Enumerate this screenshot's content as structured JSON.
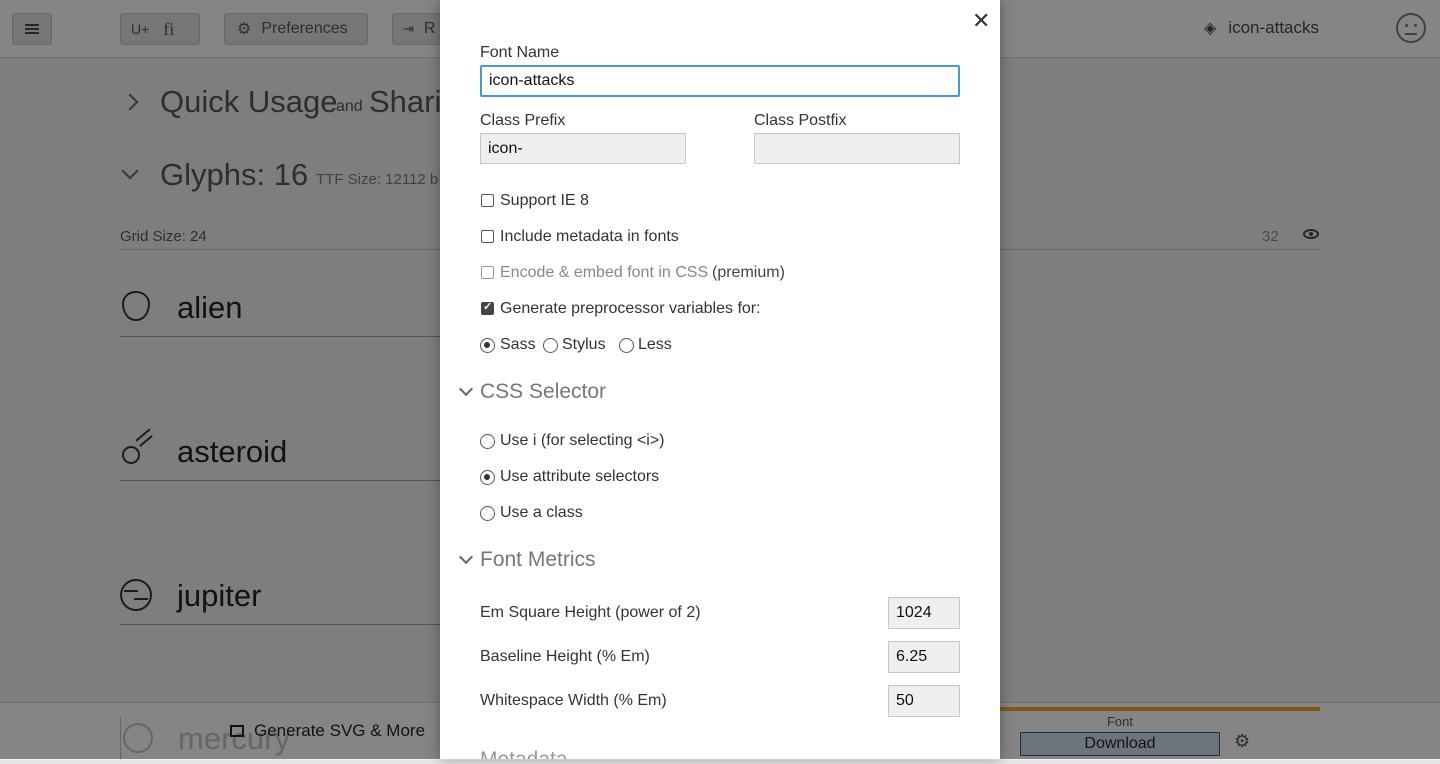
{
  "toolbar": {
    "unicode_btn": "U+",
    "ligature_btn": "fi",
    "preferences_label": "Preferences",
    "r_btn_label": "R",
    "project_name": "icon-attacks"
  },
  "main": {
    "quick_usage_title": "Quick Usage",
    "quick_usage_and": "and",
    "quick_usage_sharing": "Shari",
    "glyphs_title": "Glyphs: 16",
    "ttf_size": "TTF Size: 12112 b",
    "grid_size": "Grid Size: 24",
    "grid_value": "32",
    "glyphs": [
      {
        "name": "alien",
        "icon": "alien-icon"
      },
      {
        "name": "asteroid",
        "icon": "asteroid-icon"
      },
      {
        "name": "jupiter",
        "icon": "jupiter-icon"
      },
      {
        "name": "mercury",
        "icon": "mercury-icon"
      }
    ]
  },
  "bottombar": {
    "generate_label": "Generate SVG & More",
    "font_caption": "Font",
    "download_label": "Download"
  },
  "modal": {
    "font_name_label": "Font Name",
    "font_name_value": "icon-attacks",
    "class_prefix_label": "Class Prefix",
    "class_prefix_value": "icon-",
    "class_postfix_label": "Class Postfix",
    "class_postfix_value": "",
    "support_ie8": "Support IE 8",
    "include_metadata": "Include metadata in fonts",
    "encode_embed": "Encode & embed font in CSS",
    "premium": "(premium)",
    "generate_preprocessor": "Generate preprocessor variables for:",
    "preprocessors": [
      "Sass",
      "Stylus",
      "Less"
    ],
    "css_selector_title": "CSS Selector",
    "selector_options": [
      "Use i (for selecting <i>)",
      "Use attribute selectors",
      "Use a class"
    ],
    "font_metrics_title": "Font Metrics",
    "em_square_label": "Em Square Height (power of 2)",
    "em_square_value": "1024",
    "baseline_label": "Baseline Height (% Em)",
    "baseline_value": "6.25",
    "whitespace_label": "Whitespace Width (% Em)",
    "whitespace_value": "50",
    "metadata_title": "Metadata"
  },
  "colors": {
    "accent_focus": "#4a9bc4",
    "progress_orange": "#f0a030"
  }
}
